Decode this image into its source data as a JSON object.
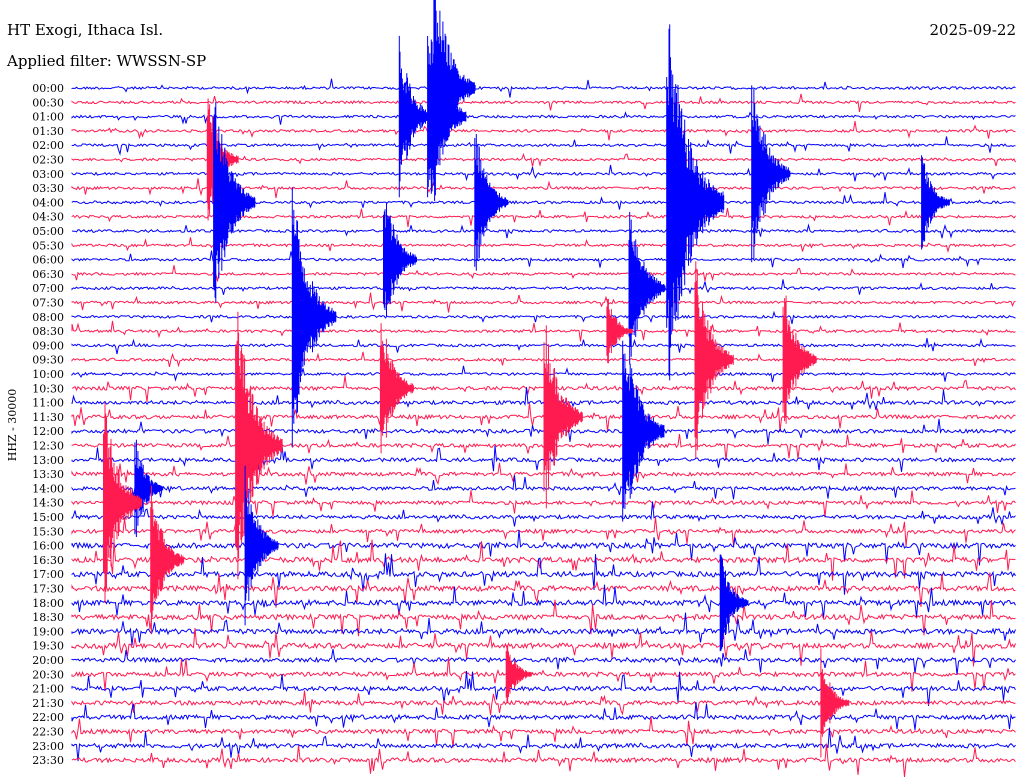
{
  "header": {
    "station": "HT Exogi, Ithaca Isl.",
    "date": "2025-09-22",
    "filter": "Applied filter: WWSSN-SP"
  },
  "chart_data": {
    "type": "line",
    "title": "HT Exogi, Ithaca Isl.",
    "subtitle": "Applied filter: WWSSN-SP",
    "date": "2025-09-22",
    "ylabel": "HHZ - 30000",
    "xlabel": "",
    "grid": false,
    "legend": "none",
    "colors": [
      "#0000ff",
      "#ff1a50"
    ],
    "time_labels": [
      "00:00",
      "00:30",
      "01:00",
      "01:30",
      "02:00",
      "02:30",
      "03:00",
      "03:30",
      "04:00",
      "04:30",
      "05:00",
      "05:30",
      "06:00",
      "06:30",
      "07:00",
      "07:30",
      "08:00",
      "08:30",
      "09:00",
      "09:30",
      "10:00",
      "10:30",
      "11:00",
      "11:30",
      "12:00",
      "12:30",
      "13:00",
      "13:30",
      "14:00",
      "14:30",
      "15:00",
      "15:30",
      "16:00",
      "16:30",
      "17:00",
      "17:30",
      "18:00",
      "18:30",
      "19:00",
      "19:30",
      "20:00",
      "20:30",
      "21:00",
      "21:30",
      "22:00",
      "22:30",
      "23:00",
      "23:30"
    ],
    "trace_minutes": 30,
    "events": [
      {
        "row": 0,
        "minute": 11.5,
        "amplitude": 9
      },
      {
        "row": 2,
        "minute": 10.4,
        "amplitude": 6
      },
      {
        "row": 2,
        "minute": 11.3,
        "amplitude": 8
      },
      {
        "row": 5,
        "minute": 4.3,
        "amplitude": 5
      },
      {
        "row": 6,
        "minute": 21.6,
        "amplitude": 8
      },
      {
        "row": 8,
        "minute": 4.5,
        "amplitude": 9
      },
      {
        "row": 8,
        "minute": 12.8,
        "amplitude": 6
      },
      {
        "row": 8,
        "minute": 18.9,
        "amplitude": 15
      },
      {
        "row": 8,
        "minute": 27.0,
        "amplitude": 4
      },
      {
        "row": 12,
        "minute": 9.9,
        "amplitude": 6
      },
      {
        "row": 14,
        "minute": 17.7,
        "amplitude": 7
      },
      {
        "row": 16,
        "minute": 7.0,
        "amplitude": 10
      },
      {
        "row": 17,
        "minute": 17.0,
        "amplitude": 3
      },
      {
        "row": 19,
        "minute": 19.8,
        "amplitude": 8
      },
      {
        "row": 19,
        "minute": 22.6,
        "amplitude": 6
      },
      {
        "row": 21,
        "minute": 9.8,
        "amplitude": 6
      },
      {
        "row": 23,
        "minute": 15.0,
        "amplitude": 8
      },
      {
        "row": 24,
        "minute": 17.5,
        "amplitude": 9
      },
      {
        "row": 25,
        "minute": 5.2,
        "amplitude": 11
      },
      {
        "row": 28,
        "minute": 2.0,
        "amplitude": 4
      },
      {
        "row": 29,
        "minute": 1.0,
        "amplitude": 8
      },
      {
        "row": 32,
        "minute": 5.5,
        "amplitude": 6
      },
      {
        "row": 33,
        "minute": 2.5,
        "amplitude": 6
      },
      {
        "row": 36,
        "minute": 20.6,
        "amplitude": 4
      },
      {
        "row": 41,
        "minute": 13.8,
        "amplitude": 3
      },
      {
        "row": 43,
        "minute": 23.8,
        "amplitude": 4
      }
    ]
  }
}
